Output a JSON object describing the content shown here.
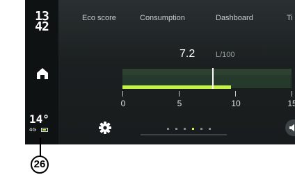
{
  "status": {
    "clock_hour": "13",
    "clock_minute": "42",
    "temperature": "14°",
    "network": "4G",
    "battery_icon": "battery-icon"
  },
  "tabs": [
    "Eco score",
    "Consumption",
    "Dashboard",
    "Ti"
  ],
  "consumption": {
    "value": "7.2",
    "unit": "L/100",
    "level": 9.6,
    "marker": 8.0,
    "scale": [
      0,
      15
    ]
  },
  "ticks": [
    "0",
    "5",
    "10",
    "15"
  ],
  "pagination": {
    "count": 6,
    "active_index": 3
  },
  "callout": {
    "label": "26"
  },
  "colors": {
    "accent": "#c6f241",
    "background": "#181c1d"
  }
}
